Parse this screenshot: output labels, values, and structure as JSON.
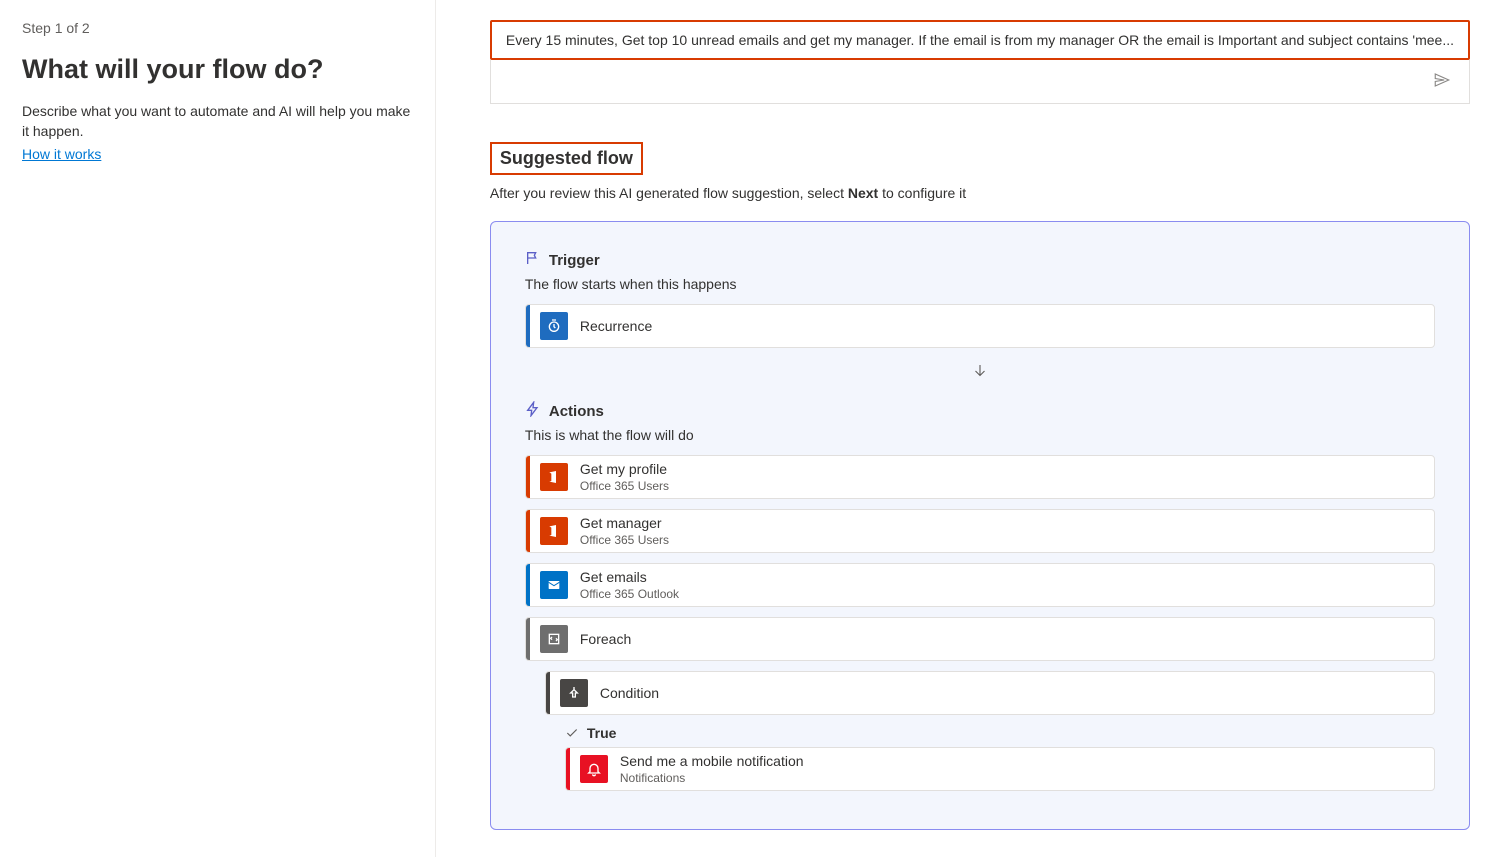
{
  "left": {
    "step": "Step 1 of 2",
    "title": "What will your flow do?",
    "desc": "Describe what you want to automate and AI will help you make it happen.",
    "how_link": "How it works"
  },
  "prompt": {
    "text": "Every 15 minutes, Get top 10 unread emails and get my manager. If the email is from my manager OR the email is Important and subject contains 'mee..."
  },
  "suggested": {
    "heading": "Suggested flow",
    "caption_pre": "After you review this AI generated flow suggestion, select ",
    "caption_bold": "Next",
    "caption_post": " to configure it"
  },
  "flow": {
    "trigger_label": "Trigger",
    "trigger_sub": "The flow starts when this happens",
    "trigger_card": {
      "title": "Recurrence",
      "color": "#1f6cbf",
      "icon_bg": "#1f6cbf"
    },
    "actions_label": "Actions",
    "actions_sub": "This is what the flow will do",
    "actions": [
      {
        "title": "Get my profile",
        "sub": "Office 365 Users",
        "color": "#d83b01",
        "icon": "office"
      },
      {
        "title": "Get manager",
        "sub": "Office 365 Users",
        "color": "#d83b01",
        "icon": "office"
      },
      {
        "title": "Get emails",
        "sub": "Office 365 Outlook",
        "color": "#0072c6",
        "icon": "outlook"
      },
      {
        "title": "Foreach",
        "sub": "",
        "color": "#6e6e6e",
        "icon": "loop"
      }
    ],
    "condition": {
      "title": "Condition",
      "color": "#484644",
      "icon": "condition"
    },
    "branch_true": "True",
    "notify": {
      "title": "Send me a mobile notification",
      "sub": "Notifications",
      "color": "#e81123",
      "icon": "bell"
    }
  }
}
